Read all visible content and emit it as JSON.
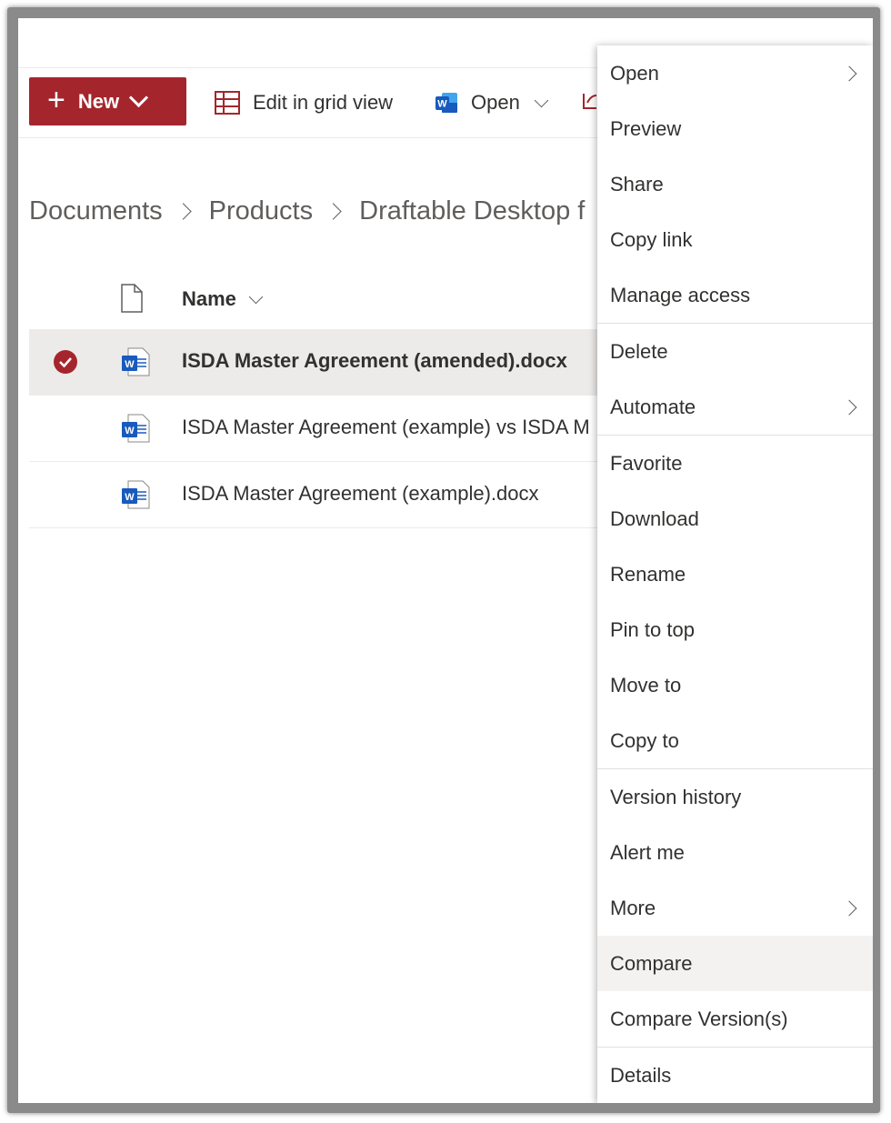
{
  "toolbar": {
    "new_label": "New",
    "edit_grid_label": "Edit in grid view",
    "open_label": "Open",
    "accent_color": "#a4262c"
  },
  "breadcrumb": [
    "Documents",
    "Products",
    "Draftable Desktop f"
  ],
  "list": {
    "name_header": "Name",
    "rows": [
      {
        "name": "ISDA Master Agreement (amended).docx",
        "selected": true
      },
      {
        "name": "ISDA Master Agreement (example) vs ISDA M",
        "selected": false
      },
      {
        "name": "ISDA Master Agreement (example).docx",
        "selected": false
      }
    ]
  },
  "context_menu": {
    "groups": [
      [
        "Open",
        "Preview",
        "Share",
        "Copy link",
        "Manage access"
      ],
      [
        "Delete",
        "Automate"
      ],
      [
        "Favorite",
        "Download",
        "Rename",
        "Pin to top",
        "Move to",
        "Copy to"
      ],
      [
        "Version history",
        "Alert me",
        "More",
        "Compare",
        "Compare Version(s)"
      ],
      [
        "Details"
      ]
    ],
    "highlighted": "Compare",
    "submenu_items": [
      "Open",
      "Automate",
      "More"
    ]
  },
  "icons": {
    "new": "plus-icon",
    "grid": "grid-view-icon",
    "word": "word-app-icon",
    "file": "document-icon",
    "check": "checkmark-circle-icon"
  }
}
